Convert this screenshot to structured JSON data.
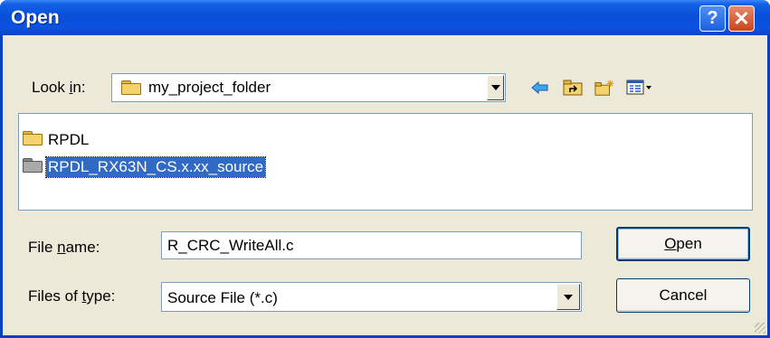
{
  "window": {
    "title": "Open"
  },
  "title_buttons": {
    "help": "?",
    "close": "✕"
  },
  "look_in": {
    "label_before": "Look ",
    "label_accel": "i",
    "label_after": "n:",
    "value": "my_project_folder"
  },
  "toolbar": {
    "back_icon": "arrow-left-icon",
    "up_icon": "folder-up-icon",
    "new_folder_icon": "new-folder-icon",
    "view_icon": "view-menu-icon"
  },
  "files": [
    {
      "name": "RPDL",
      "icon": "folder-icon",
      "selected": false
    },
    {
      "name": "RPDL_RX63N_CS.x.xx_source",
      "icon": "folder-icon",
      "selected": true
    }
  ],
  "file_name": {
    "label_before": "File ",
    "label_accel": "n",
    "label_after": "ame:",
    "value": "R_CRC_WriteAll.c"
  },
  "file_type": {
    "label_before": "Files of ",
    "label_accel": "t",
    "label_after": "ype:",
    "value": "Source File (*.c)"
  },
  "buttons": {
    "open_accel": "O",
    "open_rest": "pen",
    "cancel": "Cancel"
  },
  "colors": {
    "title_bar": "#0a4fd8",
    "selection": "#316ac5",
    "face": "#ece9d8"
  }
}
